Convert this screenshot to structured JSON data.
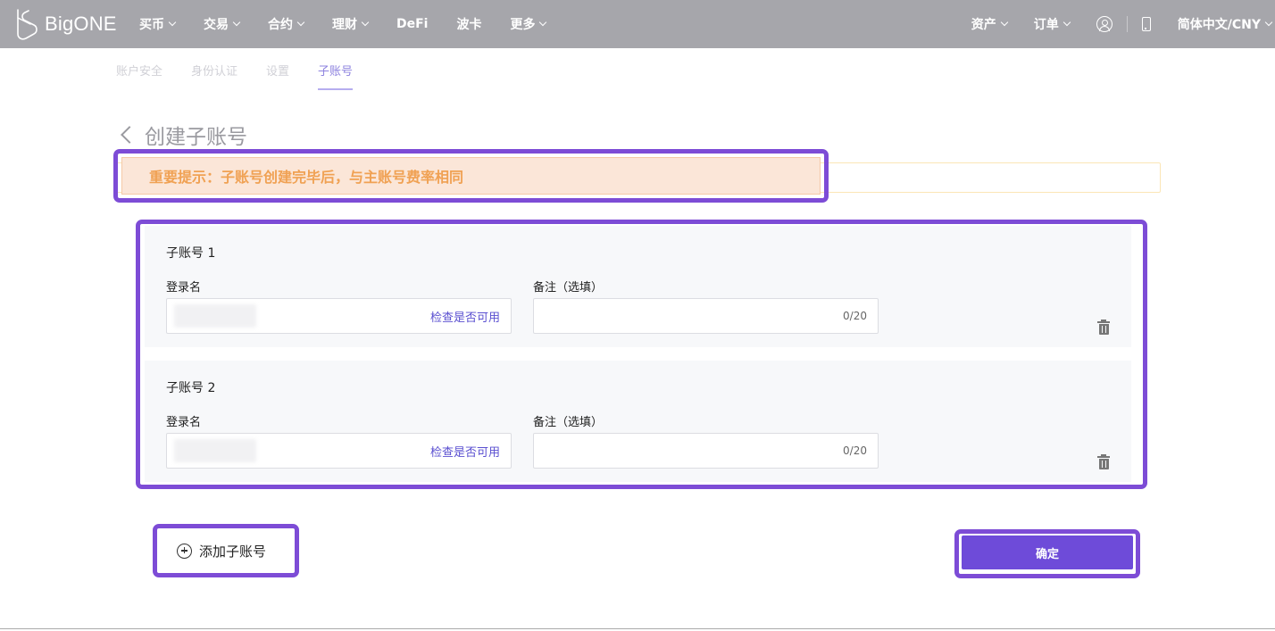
{
  "brand": {
    "name": "BigONE"
  },
  "nav": {
    "left": [
      {
        "label": "买币",
        "dropdown": true
      },
      {
        "label": "交易",
        "dropdown": true
      },
      {
        "label": "合约",
        "dropdown": true
      },
      {
        "label": "理财",
        "dropdown": true
      },
      {
        "label": "DeFi",
        "dropdown": false
      },
      {
        "label": "波卡",
        "dropdown": false
      },
      {
        "label": "更多",
        "dropdown": true
      }
    ],
    "right": {
      "assets": "资产",
      "orders": "订单",
      "language": "简体中文/CNY"
    }
  },
  "subtabs": [
    {
      "label": "账户安全",
      "active": false
    },
    {
      "label": "身份认证",
      "active": false
    },
    {
      "label": "设置",
      "active": false
    },
    {
      "label": "子账号",
      "active": true
    }
  ],
  "page": {
    "title": "创建子账号",
    "notice": "重要提示：子账号创建完毕后，与主账号费率相同"
  },
  "sub_accounts": [
    {
      "title": "子账号 1",
      "login_label": "登录名",
      "check_label": "检查是否可用",
      "note_label": "备注（选填）",
      "note_counter": "0/20"
    },
    {
      "title": "子账号 2",
      "login_label": "登录名",
      "check_label": "检查是否可用",
      "note_label": "备注（选填）",
      "note_counter": "0/20"
    }
  ],
  "actions": {
    "add_label": "添加子账号",
    "confirm_label": "确定"
  },
  "colors": {
    "nav_bg": "#a6a6ab",
    "accent": "#6e4bd9",
    "highlight": "#7d4cd6",
    "notice_text": "#f0a153",
    "notice_bg": "#fbe6d8"
  },
  "icons": [
    "logo-icon",
    "chevron-down-icon",
    "user-icon",
    "phone-icon",
    "back-arrow-icon",
    "trash-icon",
    "plus-circle-icon"
  ]
}
